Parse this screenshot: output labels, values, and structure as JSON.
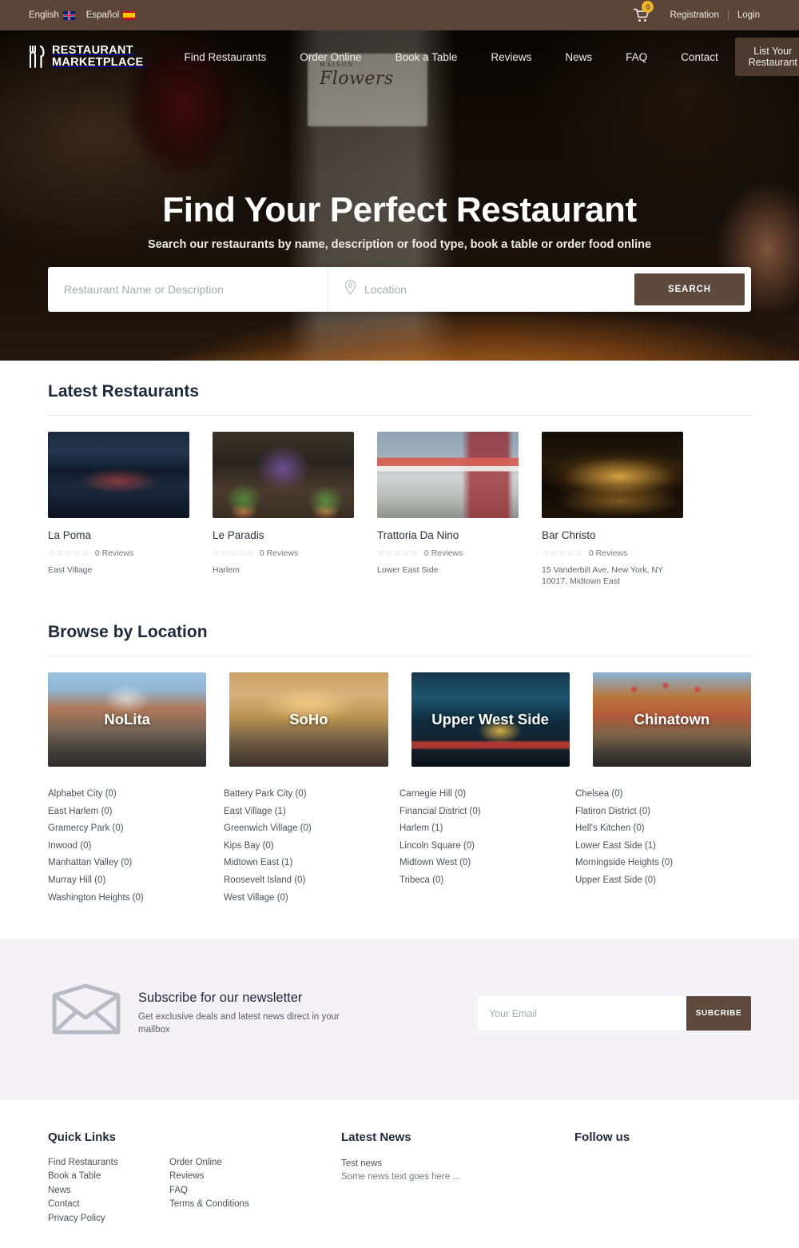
{
  "topbar": {
    "languages": [
      {
        "label": "English",
        "flag": "uk-flag-icon"
      },
      {
        "label": "Español",
        "flag": "spain-flag-icon"
      }
    ],
    "cart_count": "0",
    "registration_label": "Registration",
    "login_label": "Login"
  },
  "brand": {
    "line1": "RESTAURANT",
    "line2": "MARKETPLACE",
    "icon": "fork-knife-icon"
  },
  "nav": {
    "links": [
      "Find Restaurants",
      "Order Online",
      "Book a Table",
      "Reviews",
      "News",
      "FAQ",
      "Contact"
    ],
    "cta_label": "List Your Restaurant"
  },
  "hero": {
    "title": "Find Your Perfect Restaurant",
    "subtitle": "Search our restaurants by name, description or food type, book a table or order food online",
    "bottle_label_small": "MAISON",
    "bottle_label_text": "Flowers",
    "search": {
      "name_placeholder": "Restaurant Name or Description",
      "name_value": "",
      "location_placeholder": "Location",
      "location_value": "",
      "button_label": "SEARCH"
    }
  },
  "latest": {
    "title": "Latest Restaurants",
    "restaurants": [
      {
        "name": "La Poma",
        "stars": "☆☆☆☆☆",
        "reviews": "0 Reviews",
        "location": "East Village"
      },
      {
        "name": "Le Paradis",
        "stars": "☆☆☆☆☆",
        "reviews": "0 Reviews",
        "location": "Harlem"
      },
      {
        "name": "Trattoria Da Nino",
        "stars": "☆☆☆☆☆",
        "reviews": "0 Reviews",
        "location": "Lower East Side"
      },
      {
        "name": "Bar Christo",
        "stars": "☆☆☆☆☆",
        "reviews": "0 Reviews",
        "location": "15 Vanderbilt Ave, New York, NY 10017, Midtown East"
      }
    ]
  },
  "browse": {
    "title": "Browse by Location",
    "cards": [
      {
        "label": "NoLita"
      },
      {
        "label": "SoHo"
      },
      {
        "label": "Upper West Side"
      },
      {
        "label": "Chinatown"
      }
    ],
    "columns": [
      [
        "Alphabet City (0)",
        "East Harlem (0)",
        "Gramercy Park (0)",
        "Inwood (0)",
        "Manhattan Valley (0)",
        "Murray Hill (0)",
        "Washington Heights (0)"
      ],
      [
        "Battery Park City (0)",
        "East Village (1)",
        "Greenwich Village (0)",
        "Kips Bay (0)",
        "Midtown East (1)",
        "Roosevelt Island (0)",
        "West Village (0)"
      ],
      [
        "Carnegie Hill (0)",
        "Financial District (0)",
        "Harlem (1)",
        "Lincoln Square (0)",
        "Midtown West (0)",
        "Tribeca (0)"
      ],
      [
        "Chelsea (0)",
        "Flatiron District (0)",
        "Hell's Kitchen (0)",
        "Lower East Side (1)",
        "Morningside Heights (0)",
        "Upper East Side (0)"
      ]
    ]
  },
  "newsletter": {
    "icon": "envelope-icon",
    "heading": "Subscribe for our newsletter",
    "text": "Get exclusive deals and latest news direct in your mailbox",
    "email_placeholder": "Your Email",
    "email_value": "",
    "button_label": "SUBCRIBE"
  },
  "footer": {
    "quick_title": "Quick Links",
    "quick_col1": [
      "Find Restaurants",
      "Book a Table",
      "News",
      "Contact",
      "Privacy Policy"
    ],
    "quick_col2": [
      "Order Online",
      "Reviews",
      "FAQ",
      "Terms & Conditions"
    ],
    "news_title": "Latest News",
    "news_items": [
      {
        "title": "Test news",
        "excerpt": "Some news text goes here ..."
      }
    ],
    "follow_title": "Follow us"
  },
  "colors": {
    "topbar_brown": "#5a4538",
    "accent_brown": "#5d4a3c",
    "badge_gold": "#f0b323",
    "heading_navy": "#1e2a3a",
    "newsletter_bg": "#f4f2f6"
  }
}
